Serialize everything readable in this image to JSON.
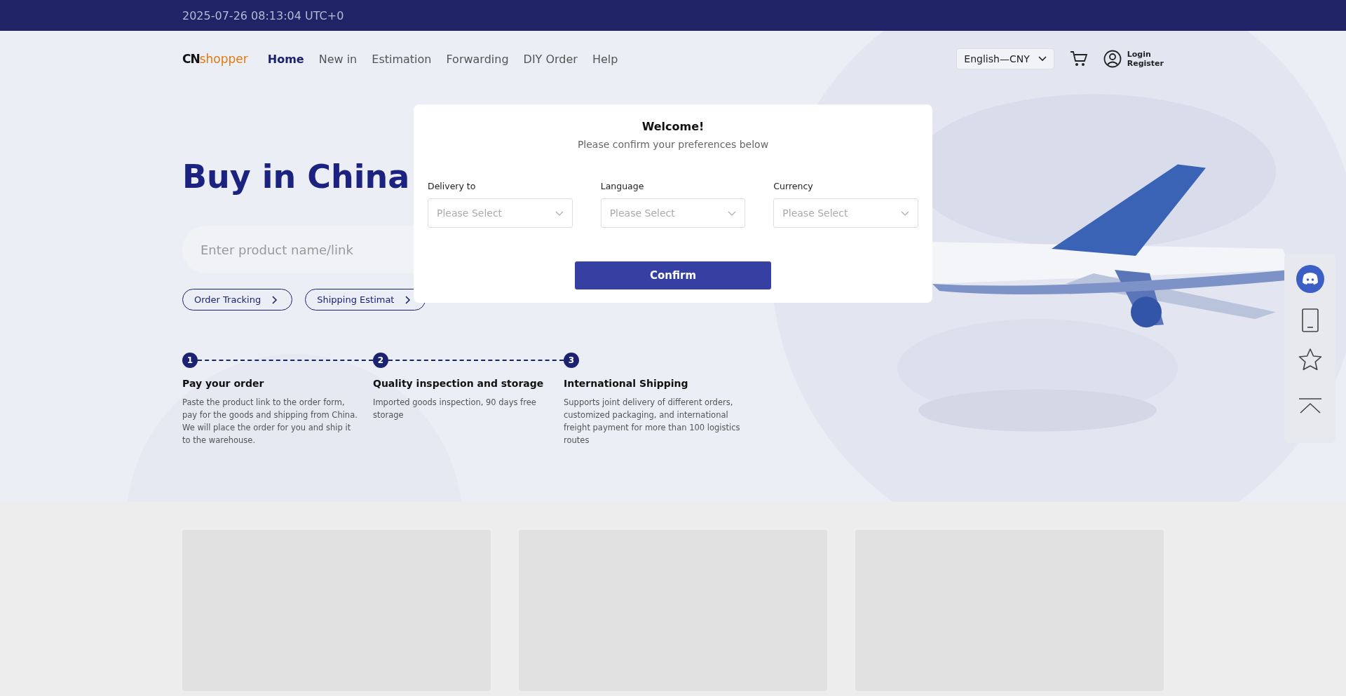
{
  "top_bar": {
    "datetime": "2025-07-26 08:13:04 UTC+0"
  },
  "header": {
    "logo": {
      "mark": "CN",
      "word": "shopper"
    },
    "nav": [
      {
        "label": "Home",
        "selected": true
      },
      {
        "label": "New in",
        "selected": false
      },
      {
        "label": "Estimation",
        "selected": false
      },
      {
        "label": "Forwarding",
        "selected": false
      },
      {
        "label": "DIY Order",
        "selected": false
      },
      {
        "label": "Help",
        "selected": false
      }
    ],
    "locale_select": "English—CNY",
    "login": "Login",
    "register": "Register"
  },
  "hero": {
    "title": "Buy in China",
    "search": {
      "placeholder": "Enter product name/link"
    },
    "links": [
      "Order Tracking",
      "Shipping Estimat"
    ],
    "steps": [
      {
        "number": "1",
        "title": "Pay your order",
        "text": "Paste the product link to the order form, pay for the goods and shipping from China. We will place the order for you and ship it to the warehouse."
      },
      {
        "number": "2",
        "title": "Quality inspection and storage",
        "text": "Imported goods inspection, 90 days free storage"
      },
      {
        "number": "3",
        "title": "International Shipping",
        "text": "Supports joint delivery of different orders, customized packaging, and international freight payment for more than 100 logistics routes"
      }
    ]
  },
  "side_panel": {
    "items": [
      {
        "kind": "discord"
      },
      {
        "kind": "tablet"
      },
      {
        "kind": "star"
      },
      {
        "kind": "top"
      }
    ]
  },
  "cards": [
    {
      "kind": "skeleton"
    },
    {
      "kind": "skeleton"
    },
    {
      "kind": "skeleton"
    }
  ],
  "modal": {
    "title": "Welcome!",
    "subtitle": "Please confirm your preferences below",
    "fields": [
      {
        "label": "Delivery to",
        "placeholder": "Please Select"
      },
      {
        "label": "Language",
        "placeholder": "Please Select"
      },
      {
        "label": "Currency",
        "placeholder": "Please Select"
      }
    ],
    "confirm": "Confirm"
  }
}
